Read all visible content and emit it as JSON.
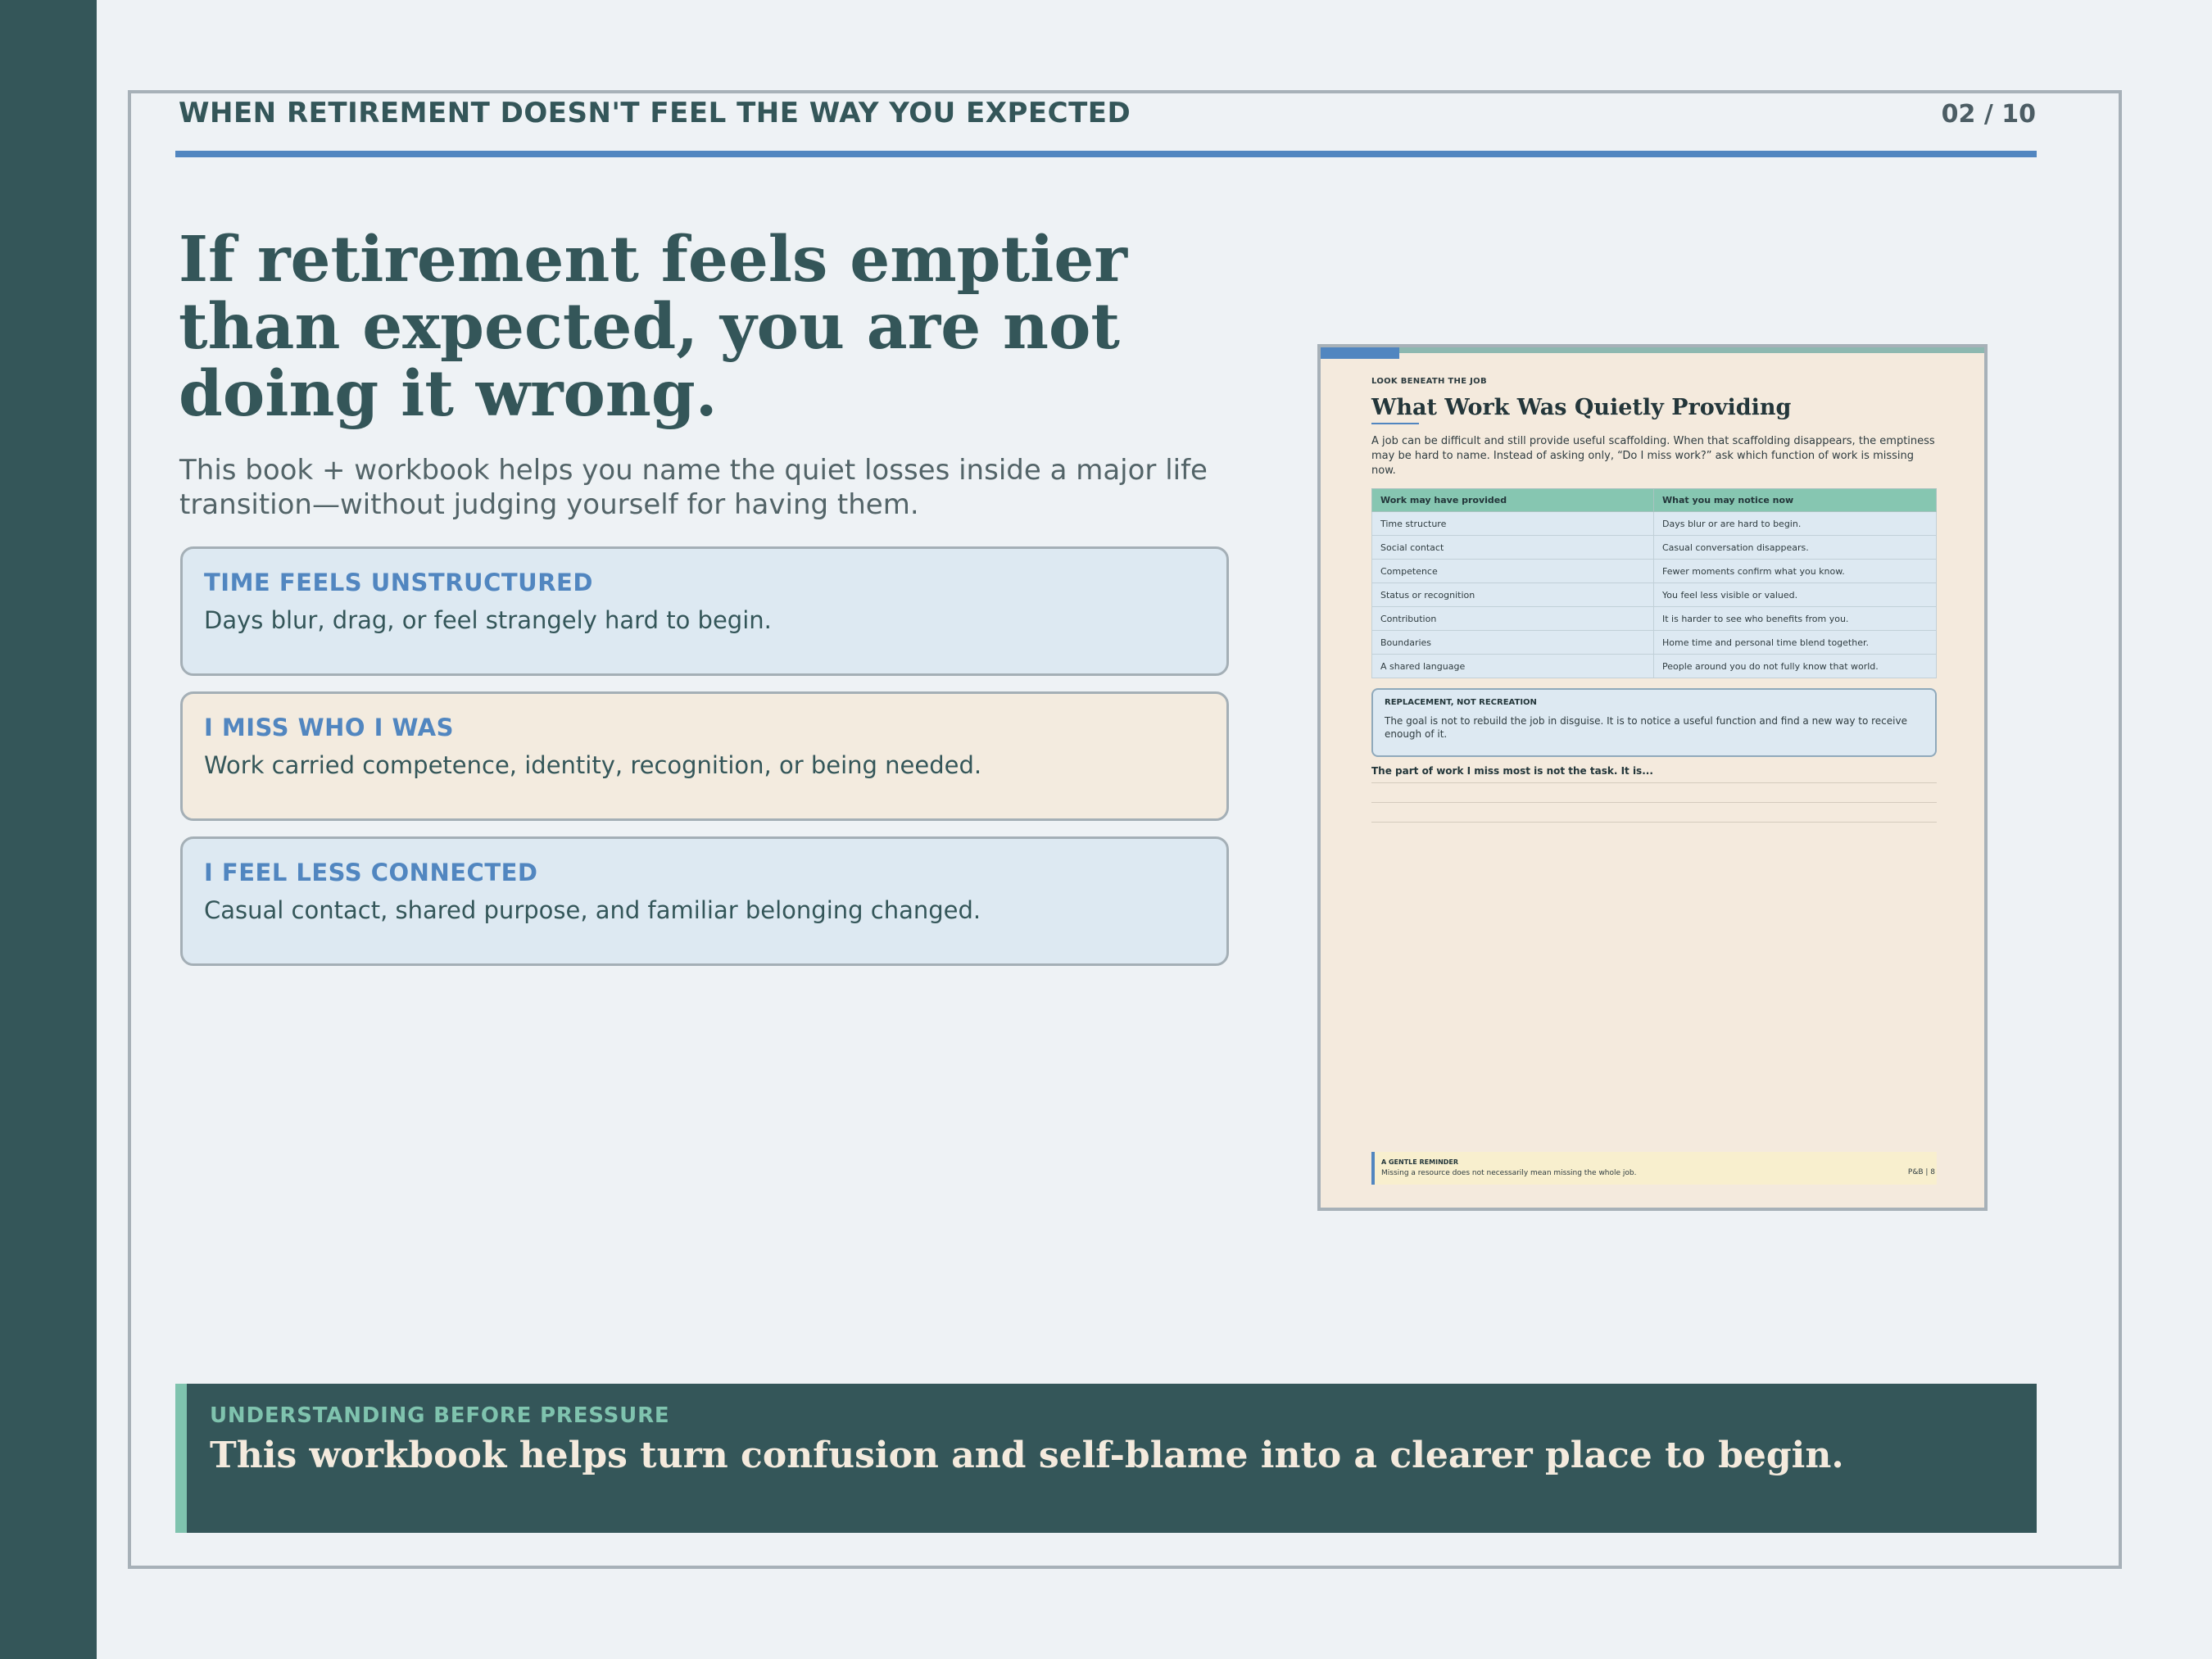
{
  "header": {
    "title": "WHEN RETIREMENT DOESN'T FEEL THE WAY YOU EXPECTED",
    "page_indicator": "02 / 10"
  },
  "hero": {
    "headline": "If retirement feels emptier than expected, you are not doing it wrong.",
    "subhead": "This book + workbook helps you name the quiet losses inside a major life transition—without judging yourself for having them."
  },
  "cards": [
    {
      "title": "TIME FEELS UNSTRUCTURED",
      "text": "Days blur, drag, or feel strangely hard to begin."
    },
    {
      "title": "I MISS WHO I WAS",
      "text": "Work carried competence, identity, recognition, or being needed."
    },
    {
      "title": "I FEEL LESS CONNECTED",
      "text": "Casual contact, shared purpose, and familiar belonging changed."
    }
  ],
  "preview": {
    "eyebrow": "LOOK BENEATH THE JOB",
    "title": "What Work Was Quietly Providing",
    "intro": "A job can be difficult and still provide useful scaffolding. When that scaffolding disappears, the emptiness may be hard to name. Instead of asking only, “Do I miss work?” ask which function of work is missing now.",
    "table": {
      "headers": [
        "Work may have provided",
        "What you may notice now"
      ],
      "rows": [
        [
          "Time structure",
          "Days blur or are hard to begin."
        ],
        [
          "Social contact",
          "Casual conversation disappears."
        ],
        [
          "Competence",
          "Fewer moments confirm what you know."
        ],
        [
          "Status or recognition",
          "You feel less visible or valued."
        ],
        [
          "Contribution",
          "It is harder to see who benefits from you."
        ],
        [
          "Boundaries",
          "Home time and personal time blend together."
        ],
        [
          "A shared language",
          "People around you do not fully know that world."
        ]
      ]
    },
    "callout": {
      "title": "REPLACEMENT, NOT RECREATION",
      "text": "The goal is not to rebuild the job in disguise. It is to notice a useful function and find a new way to receive enough of it."
    },
    "prompt": "The part of work I miss most is not the task. It is...",
    "reminder": {
      "title": "A GENTLE REMINDER",
      "text": "Missing a resource does not necessarily mean missing the whole job.",
      "page": "P&B  |  8"
    }
  },
  "banner": {
    "kicker": "UNDERSTANDING BEFORE PRESSURE",
    "text": "This workbook helps turn confusion and self-blame into a clearer place to begin."
  }
}
